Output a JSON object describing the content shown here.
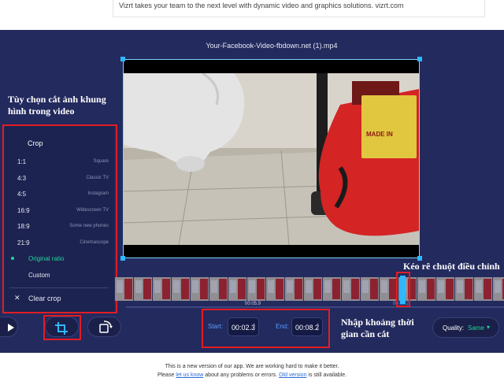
{
  "ad": {
    "text": "Vizrt takes your team to the next level with dynamic video and graphics solutions. vizrt.com"
  },
  "editor": {
    "file_name": "Your-Facebook-Video-fbdown.net (1).mp4"
  },
  "annotations": {
    "crop_options": [
      "Tùy chọn cắt ảnh khung",
      "hình trong video"
    ],
    "drag_hint": "Kéo rê chuột điều chỉnh",
    "time_range": [
      "Nhập khoảng thời",
      "gian cần cắt"
    ]
  },
  "crop_menu": {
    "title": "Crop",
    "options": [
      {
        "ratio": "1:1",
        "name": "Square"
      },
      {
        "ratio": "4:3",
        "name": "Classic TV"
      },
      {
        "ratio": "4:5",
        "name": "Instagram"
      },
      {
        "ratio": "16:9",
        "name": "Widescreen TV"
      },
      {
        "ratio": "18:9",
        "name": "Some new phones"
      },
      {
        "ratio": "21:9",
        "name": "Cinemascope"
      }
    ],
    "original_ratio": "Original ratio",
    "custom": "Custom",
    "clear_crop": "Clear crop",
    "close_symbol": "✕",
    "active_color": "#24d39a"
  },
  "timeline": {
    "time_mid": "00:05.9",
    "time_marker": "00:08.2"
  },
  "controls": {
    "play_icon": "play-icon",
    "crop_icon": "crop-icon",
    "rotate_icon": "rotate-icon",
    "start_label": "Start:",
    "start_value": "00:02.3",
    "end_label": "End:",
    "end_value": "00:08.2",
    "quality_label": "Quality:",
    "quality_value": "Same",
    "spin_up": "▲",
    "spin_down": "▼",
    "dropdown": "▾"
  },
  "footer": {
    "line1": "This is a new version of our app. We are working hard to make it better.",
    "line2_pre": "Please",
    "line2_link1": "let us know",
    "line2_mid": "about any problems or errors.",
    "line2_link2": "Old version",
    "line2_post": "is still available."
  },
  "colors": {
    "accent": "#2fb7ff",
    "annotation_red": "#e11d24",
    "editor_bg": "#232a5e"
  }
}
